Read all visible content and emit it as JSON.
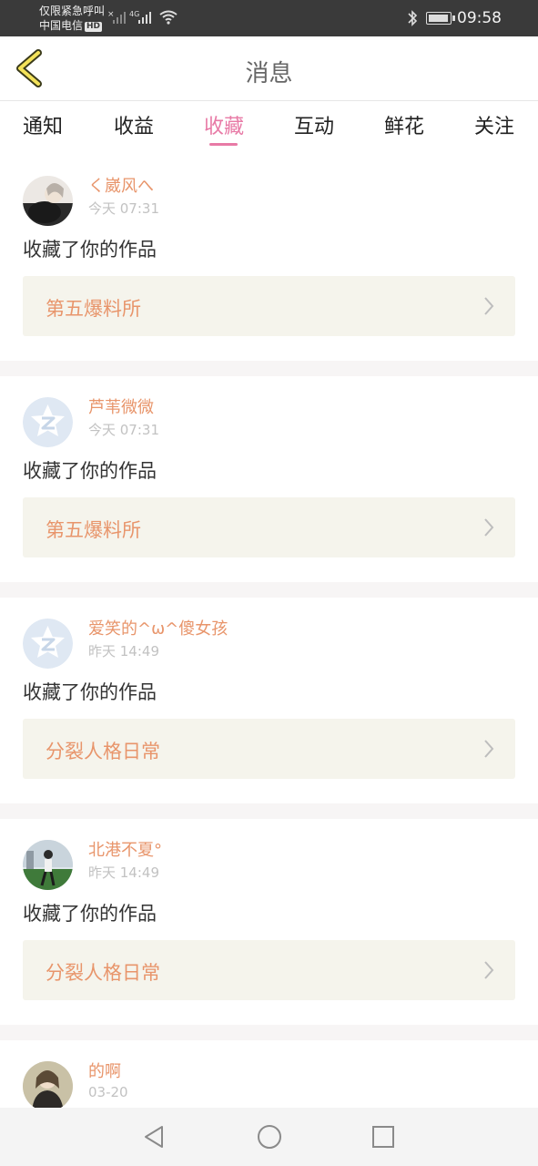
{
  "status_bar": {
    "line1": "仅限紧急呼叫",
    "line2": "中国电信",
    "hd_badge": "HD",
    "network": "4G",
    "time": "09:58"
  },
  "header": {
    "title": "消息"
  },
  "tabs": [
    {
      "label": "通知"
    },
    {
      "label": "收益"
    },
    {
      "label": "收藏"
    },
    {
      "label": "互动"
    },
    {
      "label": "鲜花"
    },
    {
      "label": "关注"
    }
  ],
  "active_tab": "收藏",
  "colors": {
    "accent_pink": "#e87aa6",
    "username_orange": "#e8956b",
    "work_card_bg": "#f5f4ec"
  },
  "feed": [
    {
      "username": "く崴风へ",
      "time": "今天 07:31",
      "action": "收藏了你的作品",
      "work": "第五爆料所",
      "avatar": "photo-avatar"
    },
    {
      "username": "芦苇微微",
      "time": "今天 07:31",
      "action": "收藏了你的作品",
      "work": "第五爆料所",
      "avatar": "default-avatar"
    },
    {
      "username": "爱笑的^ω^傻女孩",
      "time": "昨天 14:49",
      "action": "收藏了你的作品",
      "work": "分裂人格日常",
      "avatar": "default-avatar"
    },
    {
      "username": "北港不夏°",
      "time": "昨天 14:49",
      "action": "收藏了你的作品",
      "work": "分裂人格日常",
      "avatar": "photo-avatar"
    },
    {
      "username": "的啊",
      "time": "03-20",
      "action": "",
      "work": "",
      "avatar": "photo-avatar"
    }
  ]
}
